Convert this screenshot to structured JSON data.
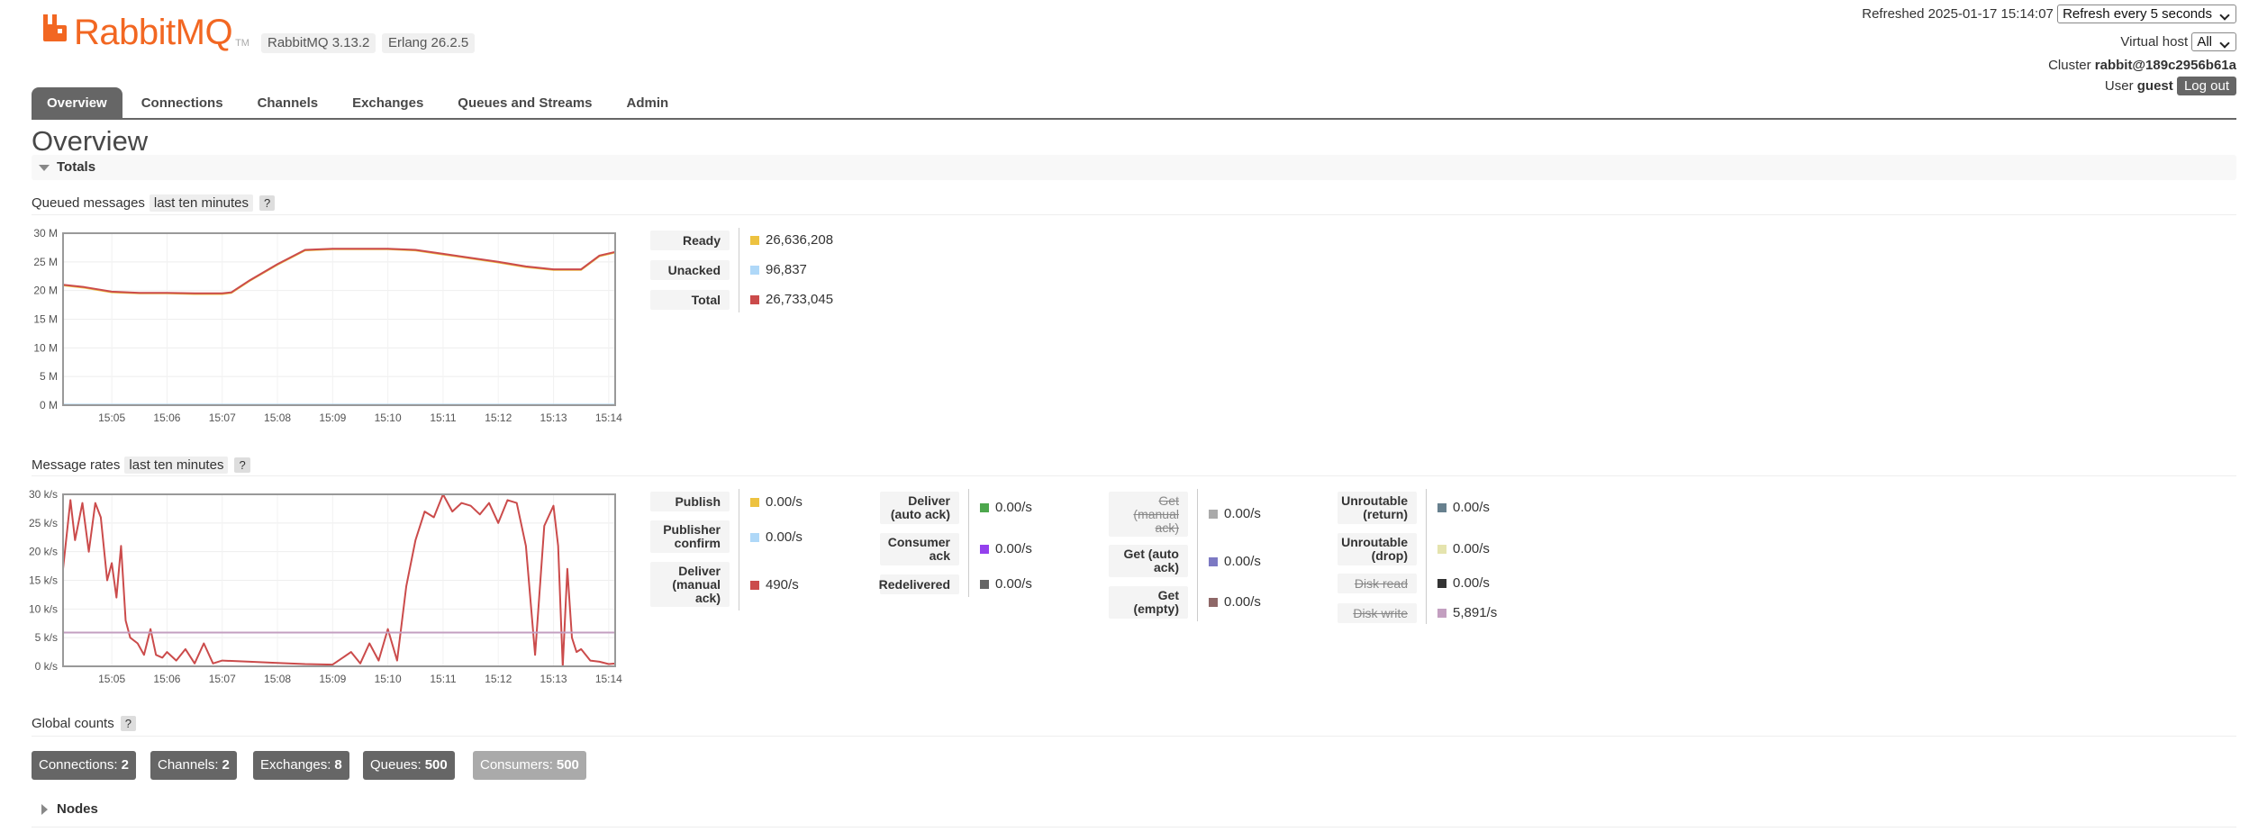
{
  "app": {
    "logo_text": "RabbitMQ",
    "logo_tm": "TM",
    "rabbitmq_version": "RabbitMQ 3.13.2",
    "erlang_version": "Erlang 26.2.5",
    "brand_color": "#f26722"
  },
  "top_right": {
    "refreshed": "Refreshed 2025-01-17 15:14:07",
    "refresh_select": "Refresh every 5 seconds",
    "vhost_label": "Virtual host",
    "vhost_select": "All",
    "cluster_label": "Cluster",
    "cluster_name": "rabbit@189c2956b61a",
    "user_label": "User",
    "user_name": "guest",
    "logout": "Log out"
  },
  "nav": {
    "tabs": [
      {
        "label": "Overview",
        "active": true
      },
      {
        "label": "Connections"
      },
      {
        "label": "Channels"
      },
      {
        "label": "Exchanges"
      },
      {
        "label": "Queues and Streams"
      },
      {
        "label": "Admin"
      }
    ]
  },
  "page_title": "Overview",
  "totals": {
    "section_title": "Totals",
    "queued": {
      "title": "Queued messages",
      "range": "last ten minutes",
      "help": "?",
      "legend": [
        {
          "label": "Ready",
          "value": "26,636,208",
          "color": "#edc240"
        },
        {
          "label": "Unacked",
          "value": "96,837",
          "color": "#afd8f8"
        },
        {
          "label": "Total",
          "value": "26,733,045",
          "color": "#cb4b4b"
        }
      ]
    },
    "rates": {
      "title": "Message rates",
      "range": "last ten minutes",
      "help": "?",
      "legend": [
        {
          "label": "Publish",
          "value": "0.00/s",
          "color": "#edc240"
        },
        {
          "label": "Publisher confirm",
          "value": "0.00/s",
          "color": "#afd8f8"
        },
        {
          "label": "Deliver (manual ack)",
          "value": "490/s",
          "color": "#cb4b4b"
        },
        {
          "label": "Deliver (auto ack)",
          "value": "0.00/s",
          "color": "#4da74d"
        },
        {
          "label": "Consumer ack",
          "value": "0.00/s",
          "color": "#9440ed"
        },
        {
          "label": "Redelivered",
          "value": "0.00/s",
          "color": "#666666"
        },
        {
          "label": "Get (manual ack)",
          "value": "0.00/s",
          "color": "#aaaaaa",
          "strike": true
        },
        {
          "label": "Get (auto ack)",
          "value": "0.00/s",
          "color": "#7c79c3"
        },
        {
          "label": "Get (empty)",
          "value": "0.00/s",
          "color": "#8e6767"
        },
        {
          "label": "Unroutable (return)",
          "value": "0.00/s",
          "color": "#67808e"
        },
        {
          "label": "Unroutable (drop)",
          "value": "0.00/s",
          "color": "#e5e4ae"
        },
        {
          "label": "Disk read",
          "value": "0.00/s",
          "color": "#333333",
          "strike": true
        },
        {
          "label": "Disk write",
          "value": "5,891/s",
          "color": "#c39fc0",
          "strike": true
        }
      ]
    }
  },
  "global_counts": {
    "title": "Global counts",
    "help": "?",
    "items": [
      {
        "label": "Connections:",
        "value": "2"
      },
      {
        "label": "Channels:",
        "value": "2"
      },
      {
        "label": "Exchanges:",
        "value": "8"
      },
      {
        "label": "Queues:",
        "value": "500"
      },
      {
        "label": "Consumers:",
        "value": "500"
      }
    ]
  },
  "nodes": {
    "title": "Nodes"
  },
  "chart_data": [
    {
      "type": "line",
      "title": "Queued messages",
      "x": [
        "15:04:07",
        "15:04:30",
        "15:05:00",
        "15:05:30",
        "15:06:00",
        "15:06:30",
        "15:07:00",
        "15:07:10",
        "15:07:30",
        "15:08:00",
        "15:08:30",
        "15:09:00",
        "15:09:30",
        "15:10:00",
        "15:10:30",
        "15:11:00",
        "15:11:30",
        "15:12:00",
        "15:12:30",
        "15:13:00",
        "15:13:30",
        "15:13:50",
        "15:14:07"
      ],
      "xticks": [
        "15:05",
        "15:06",
        "15:07",
        "15:08",
        "15:09",
        "15:10",
        "15:11",
        "15:12",
        "15:13",
        "15:14"
      ],
      "yticks": [
        "0 M",
        "5 M",
        "10 M",
        "15 M",
        "20 M",
        "25 M",
        "30 M"
      ],
      "ylim": [
        0,
        30000000
      ],
      "series": [
        {
          "name": "Ready",
          "color": "#edc240",
          "values": [
            20900000,
            20500000,
            19700000,
            19500000,
            19500000,
            19400000,
            19400000,
            19600000,
            21700000,
            24500000,
            27000000,
            27200000,
            27200000,
            27200000,
            27000000,
            26300000,
            25600000,
            24900000,
            24100000,
            23600000,
            23600000,
            26000000,
            26636208
          ]
        },
        {
          "name": "Unacked",
          "color": "#afd8f8",
          "values": [
            96837,
            96837,
            96837,
            96837,
            96837,
            96837,
            96837,
            96837,
            96837,
            96837,
            96837,
            96837,
            96837,
            96837,
            96837,
            96837,
            96837,
            96837,
            96837,
            96837,
            96837,
            96837,
            96837
          ]
        },
        {
          "name": "Total",
          "color": "#cb4b4b",
          "values": [
            21000000,
            20600000,
            19800000,
            19600000,
            19600000,
            19500000,
            19500000,
            19700000,
            21800000,
            24600000,
            27100000,
            27300000,
            27300000,
            27300000,
            27100000,
            26400000,
            25700000,
            25000000,
            24200000,
            23700000,
            23700000,
            26100000,
            26733045
          ]
        }
      ]
    },
    {
      "type": "line",
      "title": "Message rates",
      "x": [
        "15:04:07",
        "15:04:15",
        "15:04:20",
        "15:04:28",
        "15:04:35",
        "15:04:42",
        "15:04:48",
        "15:04:55",
        "15:05:00",
        "15:05:05",
        "15:05:10",
        "15:05:15",
        "15:05:20",
        "15:05:28",
        "15:05:35",
        "15:05:42",
        "15:05:48",
        "15:05:55",
        "15:06:00",
        "15:06:10",
        "15:06:20",
        "15:06:30",
        "15:06:40",
        "15:06:50",
        "15:07:00",
        "15:07:30",
        "15:08:00",
        "15:08:30",
        "15:09:00",
        "15:09:20",
        "15:09:30",
        "15:09:40",
        "15:09:50",
        "15:10:00",
        "15:10:10",
        "15:10:20",
        "15:10:30",
        "15:10:40",
        "15:10:50",
        "15:11:00",
        "15:11:10",
        "15:11:20",
        "15:11:30",
        "15:11:40",
        "15:11:50",
        "15:12:00",
        "15:12:10",
        "15:12:20",
        "15:12:30",
        "15:12:40",
        "15:12:50",
        "15:13:00",
        "15:13:05",
        "15:13:10",
        "15:13:15",
        "15:13:20",
        "15:13:25",
        "15:13:30",
        "15:13:40",
        "15:13:50",
        "15:14:00",
        "15:14:07"
      ],
      "xticks": [
        "15:05",
        "15:06",
        "15:07",
        "15:08",
        "15:09",
        "15:10",
        "15:11",
        "15:12",
        "15:13",
        "15:14"
      ],
      "yticks": [
        "0 k/s",
        "5 k/s",
        "10 k/s",
        "15 k/s",
        "20 k/s",
        "25 k/s",
        "30 k/s"
      ],
      "ylim": [
        0,
        30000
      ],
      "series": [
        {
          "name": "Publish",
          "color": "#edc240",
          "values": [
            0,
            0,
            0,
            0,
            0,
            0,
            0,
            0,
            0,
            0,
            0,
            0,
            0,
            0,
            0,
            0,
            0,
            0,
            0,
            0,
            0,
            0,
            0,
            0,
            0,
            0,
            0,
            0,
            0,
            0,
            0,
            0,
            0,
            0,
            0,
            0,
            0,
            0,
            0,
            0,
            0,
            0,
            0,
            0,
            0,
            0,
            0,
            0,
            0,
            0,
            0,
            0,
            0,
            0,
            0,
            0,
            0,
            0,
            0,
            0,
            0,
            0
          ]
        },
        {
          "name": "Deliver (manual ack)",
          "color": "#cb4b4b",
          "values": [
            17000,
            29000,
            22000,
            28500,
            20000,
            28500,
            26000,
            15000,
            18000,
            12000,
            21000,
            8000,
            5000,
            4000,
            2000,
            6500,
            2000,
            1500,
            2500,
            1000,
            3000,
            500,
            4000,
            500,
            1000,
            800,
            600,
            400,
            300,
            2500,
            500,
            4000,
            1000,
            6500,
            1000,
            14000,
            22000,
            27000,
            26000,
            30000,
            27000,
            28500,
            28000,
            26500,
            28500,
            25000,
            29000,
            28500,
            21000,
            2000,
            24500,
            28000,
            21000,
            0,
            17000,
            5000,
            2500,
            3000,
            1000,
            800,
            400,
            490
          ]
        },
        {
          "name": "Disk write",
          "color": "#c39fc0",
          "values": [
            5891,
            5891,
            5891,
            5891,
            5891,
            5891,
            5891,
            5891,
            5891,
            5891,
            5891,
            5891,
            5891,
            5891,
            5891,
            5891,
            5891,
            5891,
            5891,
            5891,
            5891,
            5891,
            5891,
            5891,
            5891,
            5891,
            5891,
            5891,
            5891,
            5891,
            5891,
            5891,
            5891,
            5891,
            5891,
            5891,
            5891,
            5891,
            5891,
            5891,
            5891,
            5891,
            5891,
            5891,
            5891,
            5891,
            5891,
            5891,
            5891,
            5891,
            5891,
            5891,
            5891,
            5891,
            5891,
            5891,
            5891,
            5891,
            5891,
            5891,
            5891,
            5891
          ]
        }
      ]
    }
  ]
}
